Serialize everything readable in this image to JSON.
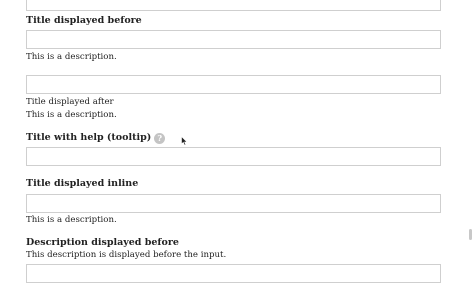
{
  "fields": {
    "before": {
      "title": "Title displayed before",
      "description": "This is a description."
    },
    "after": {
      "title": "Title displayed after",
      "description": "This is a description."
    },
    "help": {
      "title": "Title with help (tooltip)",
      "help_icon": "question-mark-icon",
      "help_glyph": "?"
    },
    "inline": {
      "title": "Title displayed inline",
      "description": "This is a description."
    },
    "desc_before": {
      "title": "Description displayed before",
      "description": "This description is displayed before the input."
    }
  }
}
